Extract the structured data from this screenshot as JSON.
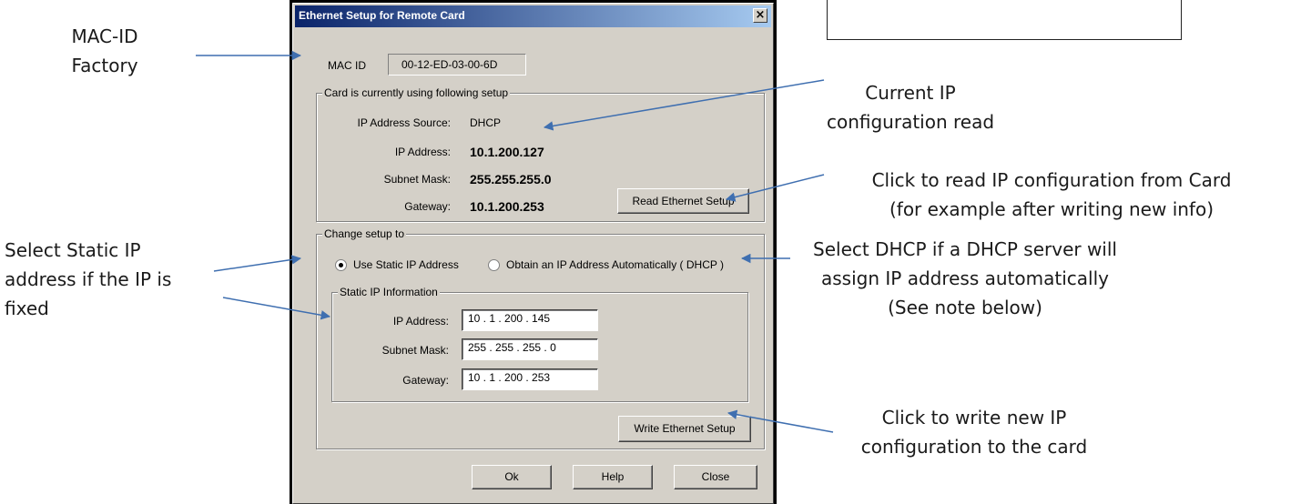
{
  "dialog": {
    "title": "Ethernet Setup for Remote Card",
    "close_glyph": "×",
    "mac": {
      "label": "MAC ID",
      "value": "00-12-ED-03-00-6D"
    },
    "current": {
      "legend": "Card is currently using following setup",
      "source_label": "IP Address Source:",
      "source_value": "DHCP",
      "ip_label": "IP Address:",
      "ip_value": "10.1.200.127",
      "mask_label": "Subnet Mask:",
      "mask_value": "255.255.255.0",
      "gw_label": "Gateway:",
      "gw_value": "10.1.200.253",
      "read_button": "Read Ethernet Setup"
    },
    "change": {
      "legend": "Change setup to",
      "radio_static": "Use Static IP Address",
      "radio_dhcp": "Obtain an IP Address Automatically ( DHCP )",
      "selected": "static",
      "static_legend": "Static IP Information",
      "ip_label": "IP Address:",
      "ip_value": "10  .  1   . 200 . 145",
      "mask_label": "Subnet Mask:",
      "mask_value": "255 . 255 . 255 .   0",
      "gw_label": "Gateway:",
      "gw_value": "10  .  1   . 200 . 253",
      "write_button": "Write Ethernet Setup"
    },
    "buttons": {
      "ok": "Ok",
      "help": "Help",
      "close": "Close"
    }
  },
  "callouts": {
    "mac": [
      "MAC-ID",
      "Factory"
    ],
    "current": [
      "Current IP",
      "configuration read"
    ],
    "read": [
      "Click to read IP configuration from Card",
      "(for example after writing new info)"
    ],
    "static": [
      "Select Static IP",
      "address if the IP is",
      "fixed"
    ],
    "dhcp": [
      "Select DHCP if a DHCP server will",
      "assign IP address automatically",
      "(See note below)"
    ],
    "write": [
      "Click to write new IP",
      "configuration to the card"
    ]
  },
  "colors": {
    "arrow": "#3f6fb0",
    "titlebar_start": "#0a246a",
    "titlebar_end": "#a6caf0",
    "window_face": "#d4d0c8"
  }
}
